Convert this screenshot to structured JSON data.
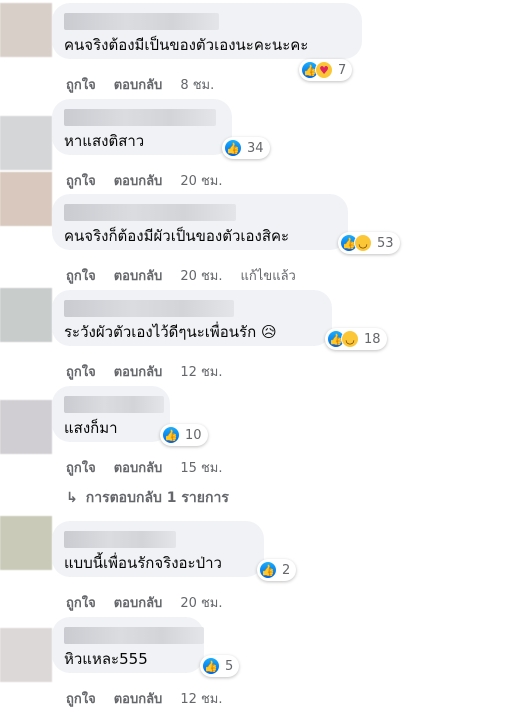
{
  "comments": [
    {
      "text": "คนจริงต้องมีเป็นของตัวเองนะคะนะคะ",
      "count": "7",
      "like": "ถูกใจ",
      "reply": "ตอบกลับ",
      "time": "8 ชม.",
      "reactions": [
        "like-icon",
        "care-icon"
      ]
    },
    {
      "text": "หาแสงติสาว",
      "count": "34",
      "like": "ถูกใจ",
      "reply": "ตอบกลับ",
      "time": "20 ชม.",
      "reactions": [
        "like-icon"
      ]
    },
    {
      "text": "คนจริงก็ต้องมีผัวเป็นของตัวเองสิคะ",
      "count": "53",
      "like": "ถูกใจ",
      "reply": "ตอบกลับ",
      "time": "20 ชม.",
      "edited": "แก้ไขแล้ว",
      "reactions": [
        "like-icon",
        "haha-icon"
      ]
    },
    {
      "text": "ระวังผัวตัวเองไว้ดีๆนะเพื่อนรัก 😥",
      "count": "18",
      "like": "ถูกใจ",
      "reply": "ตอบกลับ",
      "time": "12 ชม.",
      "reactions": [
        "like-icon",
        "haha-icon"
      ]
    },
    {
      "text": "แสงก็มา",
      "count": "10",
      "like": "ถูกใจ",
      "reply": "ตอบกลับ",
      "time": "15 ชม.",
      "reactions": [
        "like-icon"
      ]
    },
    {
      "text": "แบบนี้เพื่อนรักจริงอะป่าว",
      "count": "2",
      "like": "ถูกใจ",
      "reply": "ตอบกลับ",
      "time": "20 ชม.",
      "reactions": [
        "like-icon"
      ]
    },
    {
      "text": "หิวแหละ555",
      "count": "5",
      "like": "ถูกใจ",
      "reply": "ตอบกลับ",
      "time": "12 ชม.",
      "reactions": [
        "like-icon"
      ]
    }
  ],
  "replies_link": {
    "arrow": "↳",
    "label": "การตอบกลับ 1 รายการ"
  },
  "colors": {
    "bubble": "#f0f2f5",
    "meta": "#65676b",
    "like_blue": "#0866ff"
  }
}
